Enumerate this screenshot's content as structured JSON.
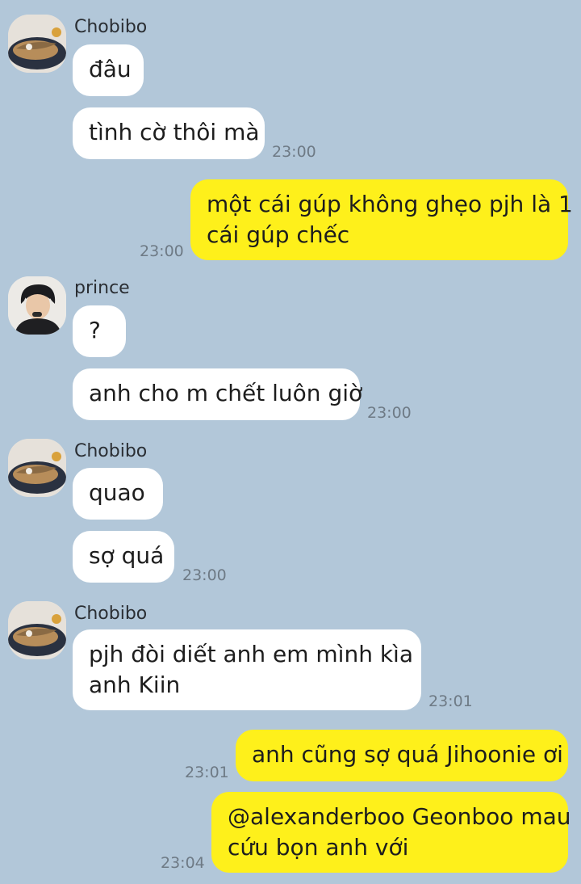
{
  "chat": {
    "group1": {
      "sender": "Chobibo",
      "messages": [
        "đâu",
        "tình cờ thôi mà"
      ],
      "time": "23:00",
      "avatar_icon": "food-photo-avatar-icon"
    },
    "my1": {
      "lines": [
        "một cái gúp không ghẹo pjh là 1",
        "cái gúp chếc"
      ],
      "time": "23:00"
    },
    "group2": {
      "sender": "prince",
      "messages": [
        "?",
        "anh cho m chết luôn giờ"
      ],
      "time": "23:00",
      "avatar_icon": "person-photo-avatar-icon"
    },
    "group3": {
      "sender": "Chobibo",
      "messages": [
        "quao",
        "sợ quá"
      ],
      "time": "23:00",
      "avatar_icon": "food-photo-avatar-icon"
    },
    "group4": {
      "sender": "Chobibo",
      "lines": [
        "pjh đòi diết anh em mình kìa",
        "anh Kiin"
      ],
      "time": "23:01",
      "avatar_icon": "food-photo-avatar-icon"
    },
    "my2": {
      "text": "anh cũng sợ quá Jihoonie ơi",
      "time": "23:01"
    },
    "my3": {
      "lines": [
        "@alexanderboo Geonboo mau",
        "cứu bọn anh với"
      ],
      "time": "23:04"
    }
  },
  "colors": {
    "background": "#b2c7d9",
    "incoming_bubble": "#ffffff",
    "outgoing_bubble": "#fef01b",
    "timestamp": "#6e7a85"
  }
}
